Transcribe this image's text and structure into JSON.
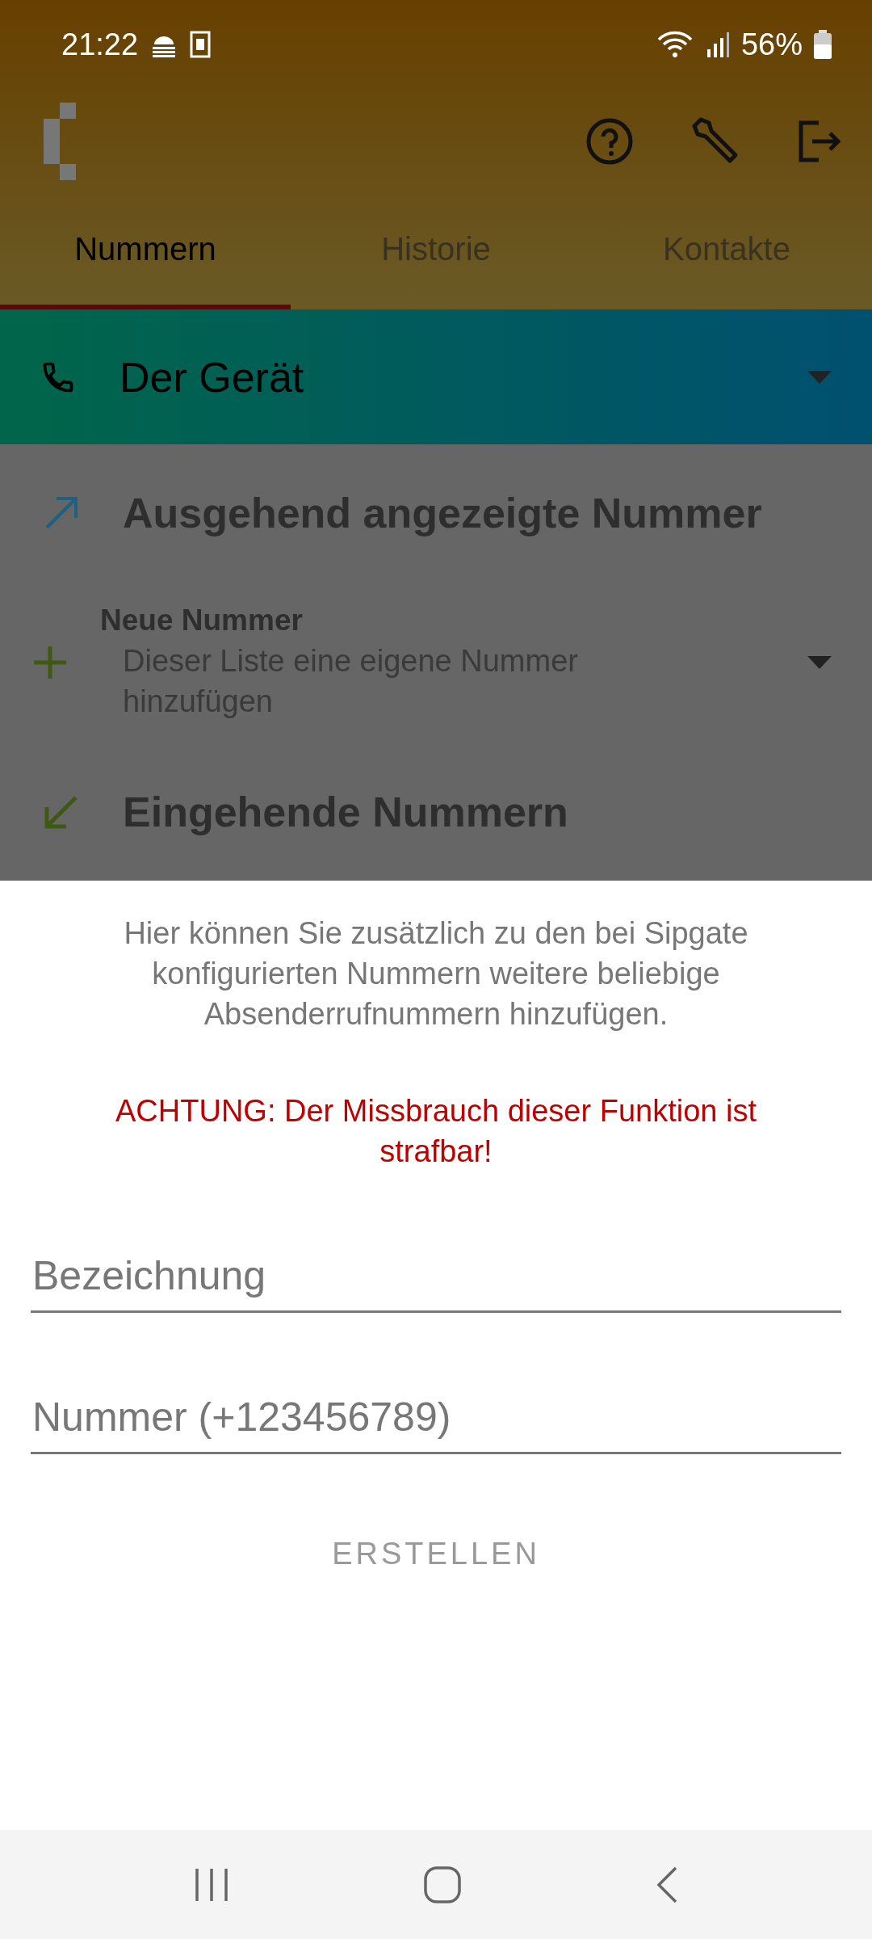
{
  "status_bar": {
    "time": "21:22",
    "battery": "56%"
  },
  "tabs": [
    {
      "label": "Nummern",
      "selected": true
    },
    {
      "label": "Historie",
      "selected": false
    },
    {
      "label": "Kontakte",
      "selected": false
    }
  ],
  "device_selector": {
    "label": "Der Gerät"
  },
  "outgoing": {
    "title": "Ausgehend angezeigte Nummer",
    "new_number": {
      "title": "Neue Nummer",
      "subtitle": "Dieser Liste eine eigene Nummer hinzufügen"
    }
  },
  "incoming": {
    "title": "Eingehende Nummern"
  },
  "sheet": {
    "description": "Hier können Sie zusätzlich zu den bei Sipgate konfigurierten Nummern weitere beliebige Absenderrufnummern hinzufügen.",
    "warning": "ACHTUNG: Der Missbrauch dieser Funktion ist strafbar!",
    "fields": [
      {
        "placeholder": "Bezeichnung"
      },
      {
        "placeholder": "Nummer (+123456789)"
      }
    ],
    "button": {
      "label": "ERSTELLEN",
      "disabled": true
    }
  }
}
